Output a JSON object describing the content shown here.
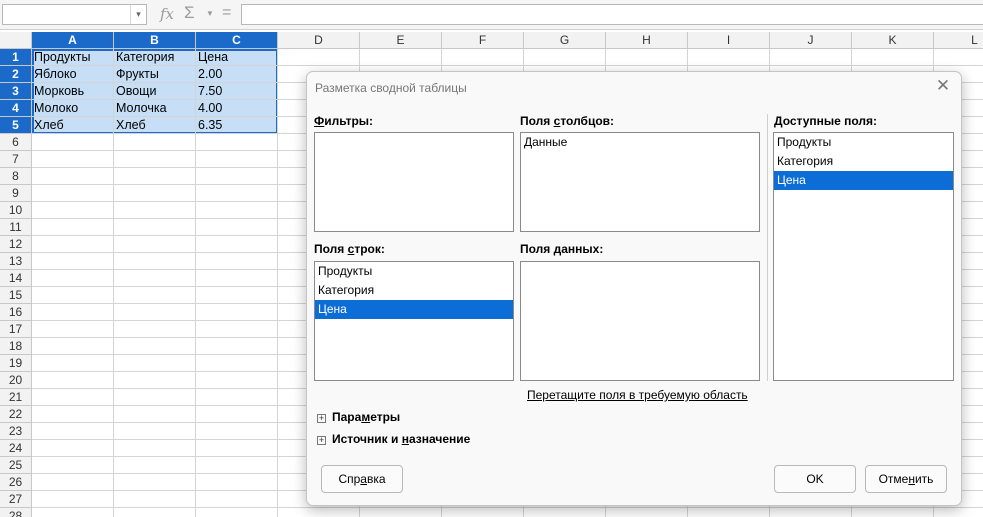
{
  "formula_bar": {
    "name_box_value": "",
    "function_wizard_icon": "fx-icon",
    "sum_icon": "sigma-icon",
    "equals_icon": "equals-icon",
    "formula_value": ""
  },
  "sheet": {
    "columns": [
      "A",
      "B",
      "C",
      "D",
      "E",
      "F",
      "G",
      "H",
      "I",
      "J",
      "K",
      "L"
    ],
    "rows": [
      "1",
      "2",
      "3",
      "4",
      "5",
      "6",
      "7",
      "8",
      "9",
      "10",
      "11",
      "12",
      "13",
      "14",
      "15",
      "16",
      "17",
      "18",
      "19",
      "20",
      "21",
      "22",
      "23",
      "24",
      "25",
      "26",
      "27",
      "28"
    ],
    "cells": [
      [
        "Продукты",
        "Категория",
        "Цена"
      ],
      [
        "Яблоко",
        "Фрукты",
        "2.00"
      ],
      [
        "Морковь",
        "Овощи",
        "7.50"
      ],
      [
        "Молоко",
        "Молочка",
        "4.00"
      ],
      [
        "Хлеб",
        "Хлеб",
        "6.35"
      ]
    ],
    "selected_range": "A1:C5"
  },
  "dialog": {
    "title": "Разметка сводной таблицы",
    "filters": {
      "label_pre": "",
      "label_u": "Ф",
      "label_post": "ильтры:",
      "items": []
    },
    "column_fields": {
      "label_pre": "Поля ",
      "label_u": "с",
      "label_post": "толбцов:",
      "items": [
        "Данные"
      ]
    },
    "row_fields": {
      "label_pre": "Поля ",
      "label_u": "с",
      "label_post": "трок:",
      "items": [
        "Продукты",
        "Категория",
        "Цена"
      ],
      "selected": "Цена"
    },
    "data_fields": {
      "label_pre": "Поля ",
      "label_u": "д",
      "label_post": "анных:",
      "items": []
    },
    "available_fields": {
      "label_pre": "",
      "label_u": "Д",
      "label_post": "оступные поля:",
      "items": [
        "Продукты",
        "Категория",
        "Цена"
      ],
      "selected": "Цена"
    },
    "hint": "Перетащите поля в требуемую область",
    "options": {
      "label_pre": "Пара",
      "label_u": "м",
      "label_post": "етры"
    },
    "source_dest": {
      "label_pre": "Источник и ",
      "label_u": "н",
      "label_post": "азначение"
    },
    "help_button": {
      "pre": "Спр",
      "u": "а",
      "post": "вка"
    },
    "ok_button": "OK",
    "cancel_button": {
      "pre": "Отме",
      "u": "н",
      "post": "ить"
    }
  },
  "colors": {
    "selection_header": "#1b6ac9",
    "selection_fill": "#c6dff7",
    "list_selection": "#0c6dd6"
  }
}
